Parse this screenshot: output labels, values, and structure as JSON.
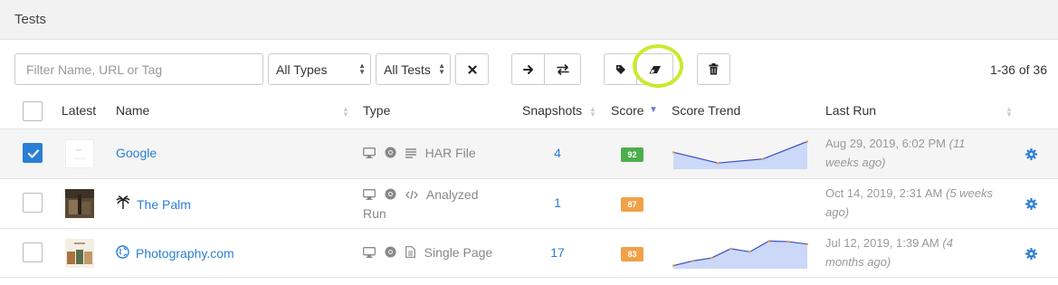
{
  "header": {
    "title": "Tests"
  },
  "toolbar": {
    "filter_placeholder": "Filter Name, URL or Tag",
    "type_select": "All Types",
    "tests_select": "All Tests",
    "count": "1-36 of 36"
  },
  "columns": {
    "latest": "Latest",
    "name": "Name",
    "type": "Type",
    "snapshots": "Snapshots",
    "score": "Score",
    "score_trend": "Score Trend",
    "last_run": "Last Run"
  },
  "rows": [
    {
      "checked": true,
      "name": "Google",
      "name_icon": "none",
      "type_line1": "HAR File",
      "type_line2": "",
      "type_icons": [
        "monitor-icon",
        "chrome-icon",
        "list-icon"
      ],
      "snapshots": "4",
      "score": "92",
      "score_color": "#4cae4c",
      "last_run_date": "Aug 29, 2019, 6:02 PM",
      "last_run_ago1": "(11",
      "last_run_line2": "weeks ago)",
      "trend": [
        0.55,
        0.2,
        0.33,
        0.9
      ]
    },
    {
      "checked": false,
      "name": "The Palm",
      "name_icon": "palm-tree-icon",
      "type_line1": "Analyzed",
      "type_line2": "Run",
      "type_icons": [
        "monitor-icon",
        "chrome-icon",
        "code-icon"
      ],
      "snapshots": "1",
      "score": "87",
      "score_color": "#f0a14a",
      "last_run_date": "Oct 14, 2019, 2:31 AM",
      "last_run_ago1": "(5 weeks",
      "last_run_line2": "ago)",
      "trend": []
    },
    {
      "checked": false,
      "name": "Photography.com",
      "name_icon": "globe-icon",
      "type_line1": "Single Page",
      "type_line2": "",
      "type_icons": [
        "monitor-icon",
        "chrome-icon",
        "page-icon"
      ],
      "snapshots": "17",
      "score": "83",
      "score_color": "#f0a14a",
      "last_run_date": "Jul 12, 2019, 1:39 AM",
      "last_run_ago1": "(4",
      "last_run_line2": "months ago)",
      "trend": [
        0.1,
        0.25,
        0.35,
        0.65,
        0.55,
        0.9,
        0.88,
        0.8
      ]
    }
  ],
  "colors": {
    "accent": "#2b7fd6",
    "highlight": "#c9ea2e",
    "trend_line": "#3b4cc4",
    "trend_fill": "#cbd8f8",
    "trend_dot": "#f0a14a"
  }
}
